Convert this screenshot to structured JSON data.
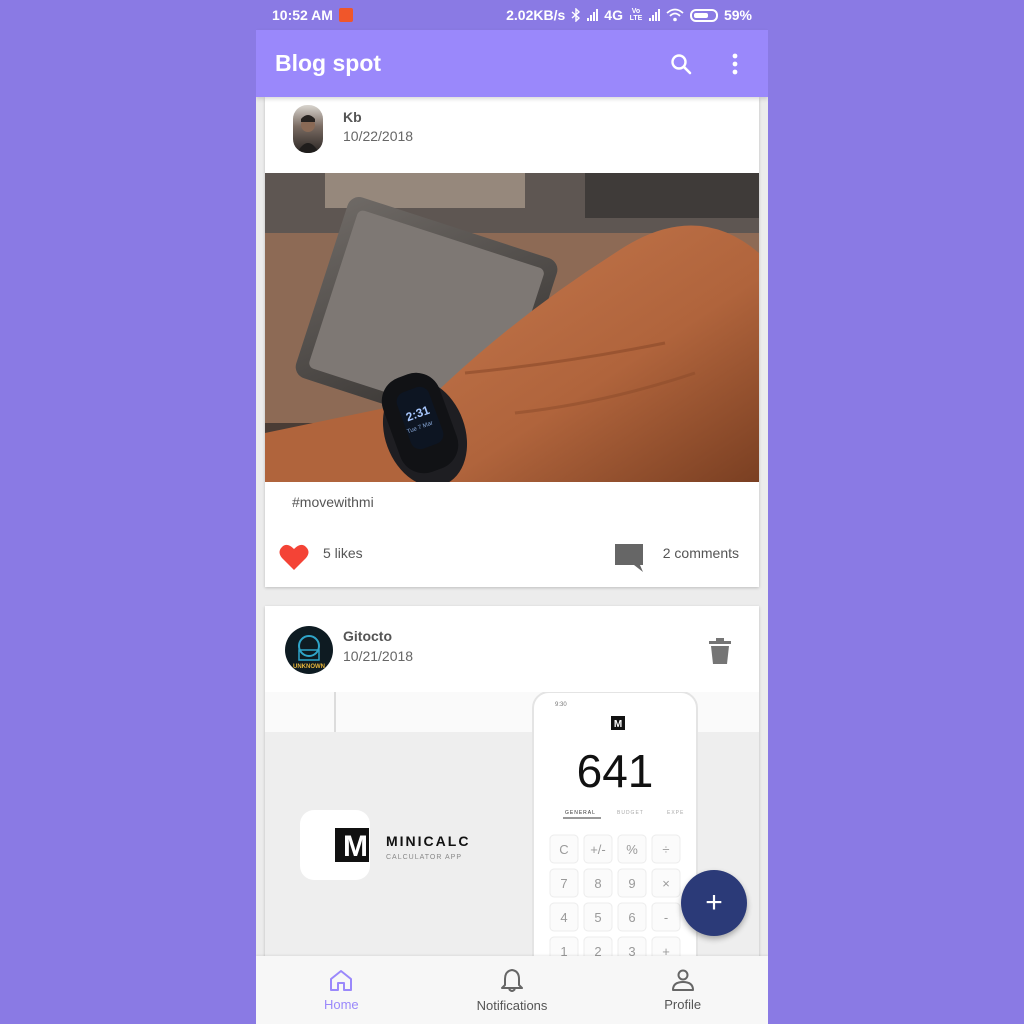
{
  "status_bar": {
    "time": "10:52 AM",
    "speed": "2.02KB/s",
    "network": "4G",
    "volte": "Vo LTE",
    "battery": "59%"
  },
  "app_bar": {
    "title": "Blog spot",
    "icons": [
      "search-icon",
      "more-vert-icon"
    ]
  },
  "posts": [
    {
      "author": "Kb",
      "date": "10/22/2018",
      "caption": "#movewithmi",
      "likes": "5 likes",
      "comments": "2 comments",
      "image_text": {
        "time": "2:31",
        "day": "Tue 7 Mar"
      }
    },
    {
      "author": "Gitocto",
      "date": "10/21/2018",
      "avatar_text": "UNKNOWN",
      "image_text": {
        "app_name": "MINICALC",
        "app_sub": "CALCULATOR APP",
        "logo": "M",
        "phone_time": "9:30",
        "display": "641",
        "tabs": [
          "GENERAL",
          "BUDGET",
          "EXPE"
        ],
        "keys": [
          "C",
          "+/-",
          "%",
          "÷",
          "7",
          "8",
          "9",
          "×",
          "4",
          "5",
          "6",
          "-",
          "1",
          "2",
          "3",
          "+"
        ]
      }
    }
  ],
  "fab": {
    "label": "+"
  },
  "bottom_nav": [
    {
      "label": "Home",
      "icon": "home-icon",
      "active": true
    },
    {
      "label": "Notifications",
      "icon": "bell-icon",
      "active": false
    },
    {
      "label": "Profile",
      "icon": "person-icon",
      "active": false
    }
  ],
  "colors": {
    "background": "#8a7ae4",
    "app_bar": "#9a88fb",
    "fab": "#2b3a78",
    "like": "#f44336",
    "active_nav": "#9a88fb"
  }
}
